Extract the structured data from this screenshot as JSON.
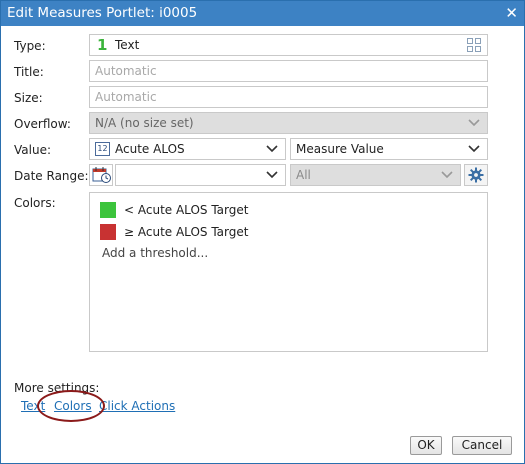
{
  "dialog": {
    "title": "Edit Measures Portlet: i0005",
    "close_glyph": "✕"
  },
  "form": {
    "type": {
      "label": "Type:",
      "icon_text": "1",
      "value": "Text"
    },
    "title": {
      "label": "Title:",
      "placeholder": "Automatic"
    },
    "size": {
      "label": "Size:",
      "placeholder": "Automatic"
    },
    "overflow": {
      "label": "Overflow:",
      "value": "N/A (no size set)"
    },
    "value": {
      "label": "Value:",
      "icon_text": "12",
      "measure": "Acute ALOS",
      "kind": "Measure Value"
    },
    "date_range": {
      "label": "Date Range:",
      "value": "",
      "period": "All"
    },
    "colors": {
      "label": "Colors:",
      "thresholds": [
        {
          "text": "< Acute ALOS Target",
          "color": "#3cc43c"
        },
        {
          "text": "≥ Acute ALOS Target",
          "color": "#c83232"
        }
      ],
      "add_label": "Add a threshold..."
    }
  },
  "more_settings": {
    "label": "More settings:",
    "links": [
      "Text",
      "Colors",
      "Click Actions"
    ]
  },
  "buttons": {
    "ok": "OK",
    "cancel": "Cancel"
  },
  "colors": {
    "titlebar": "#3d82c4",
    "link": "#1f6fb5",
    "highlight_ring": "#8b1a1a"
  }
}
